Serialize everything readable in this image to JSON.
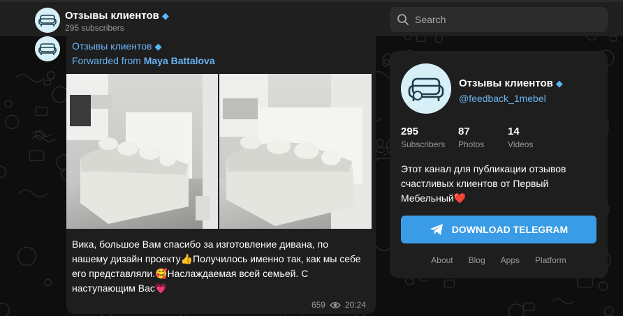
{
  "header": {
    "channel_name": "Отзывы клиентов",
    "subscribers": "295 subscribers",
    "gem_icon": "gem-icon"
  },
  "search": {
    "placeholder": "Search"
  },
  "message": {
    "channel_name": "Отзывы клиентов",
    "forwarded_prefix": "Forwarded from ",
    "forwarded_author": "Maya Battalova",
    "text": "Вика, большое Вам спасибо за изготовление дивана, по нашему дизайн проекту👍Получилось именно так, как мы себе его представляли.🥰Наслаждаемая всей семьей. С наступающим Вас💗",
    "views": "659",
    "time": "20:24"
  },
  "card": {
    "title": "Отзывы клиентов",
    "handle": "@feedback_1mebel",
    "stats": [
      {
        "value": "295",
        "label": "Subscribers"
      },
      {
        "value": "87",
        "label": "Photos"
      },
      {
        "value": "14",
        "label": "Videos"
      }
    ],
    "description": "Этот канал для публикации отзывов счастливых клиентов от Первый Мебельный❤️",
    "download_label": "DOWNLOAD TELEGRAM",
    "links": [
      "About",
      "Blog",
      "Apps",
      "Platform"
    ]
  },
  "colors": {
    "accent": "#3a9ce6",
    "link": "#6ab3f3",
    "background": "#0e0e0e",
    "panel": "#1e1e1e"
  }
}
